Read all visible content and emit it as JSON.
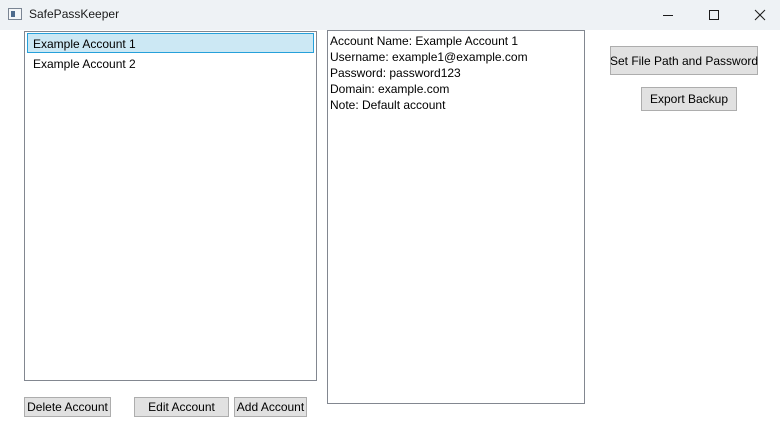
{
  "window": {
    "title": "SafePassKeeper"
  },
  "accounts": [
    {
      "label": "Example Account 1",
      "selected": true
    },
    {
      "label": "Example Account 2",
      "selected": false
    }
  ],
  "details": {
    "account_name": "Account Name: Example Account 1",
    "username": "Username: example1@example.com",
    "password": "Password: password123",
    "domain": "Domain: example.com",
    "note": "Note: Default account"
  },
  "buttons": {
    "set_path": "Set File Path and Password",
    "export_backup": "Export Backup",
    "delete_account": "Delete Account",
    "edit_account": "Edit Account",
    "add_account": "Add Account"
  },
  "colors": {
    "selection_bg": "#cce8f4",
    "selection_border": "#26a0da",
    "button_bg": "#e1e1e1",
    "titlebar_bg": "#eef2f5"
  },
  "icons": [
    "app-icon",
    "minimize-icon",
    "maximize-icon",
    "close-icon"
  ]
}
